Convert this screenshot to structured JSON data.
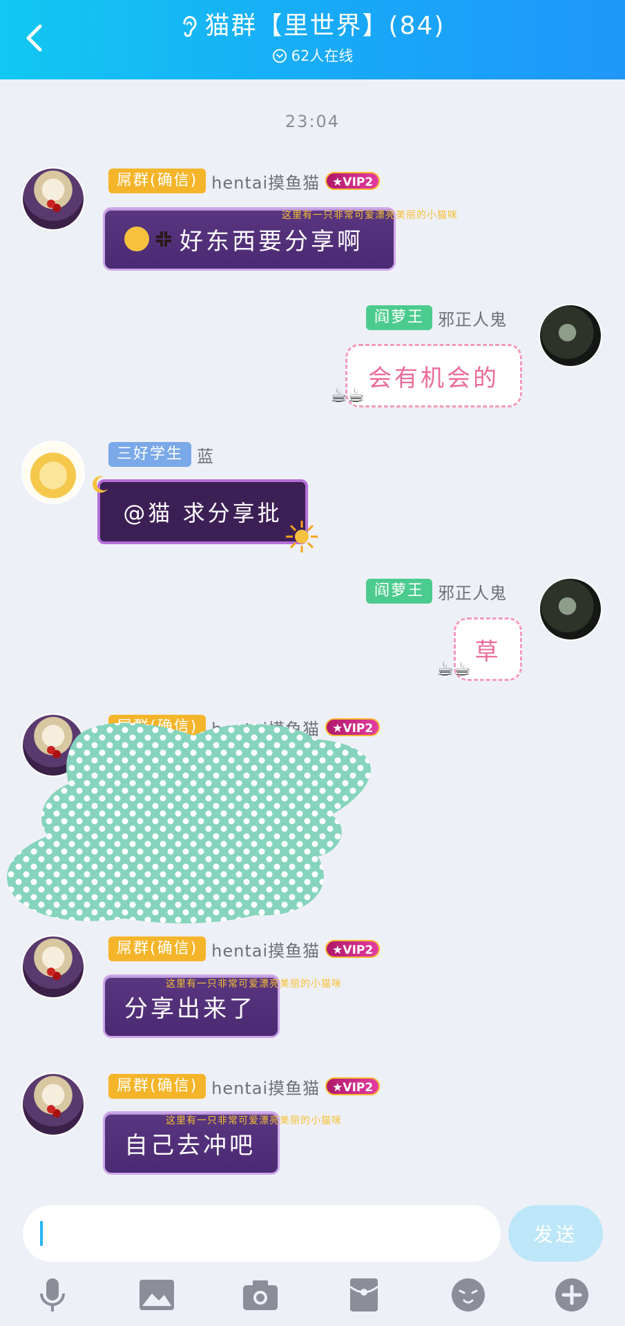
{
  "header": {
    "title": "猫群【里世界】(84)",
    "online": "62人在线"
  },
  "timestamp": "23:04",
  "messages": [
    {
      "badge": "屌群(确信)",
      "nick": "hentai摸鱼猫",
      "vip": "VIP2",
      "note": "这里有一只非常可爱漂亮美丽的小猫咪",
      "text": "好东西要分享啊"
    },
    {
      "badge": "阎萝王",
      "nick": "邪正人鬼",
      "text": "会有机会的"
    },
    {
      "badge": "三好学生",
      "nick": "蓝",
      "text": "@猫 求分享批"
    },
    {
      "badge": "阎萝王",
      "nick": "邪正人鬼",
      "text": "草"
    },
    {
      "badge": "屌群(确信)",
      "nick": "hentai摸鱼猫",
      "vip": "VIP2"
    },
    {
      "badge": "屌群(确信)",
      "nick": "hentai摸鱼猫",
      "vip": "VIP2",
      "note": "这里有一只非常可爱漂亮美丽的小猫咪",
      "text": "分享出来了"
    },
    {
      "badge": "屌群(确信)",
      "nick": "hentai摸鱼猫",
      "vip": "VIP2",
      "note": "这里有一只非常可爱漂亮美丽的小猫咪",
      "text": "自己去冲吧"
    }
  ],
  "input": {
    "send_label": "发送"
  },
  "toolbar": [
    "mic-icon",
    "image-icon",
    "camera-icon",
    "red-packet-icon",
    "emoji-icon",
    "plus-icon"
  ],
  "colors": {
    "header_start": "#12c8f2",
    "header_end": "#1e97fb",
    "badge_gold": "#f5b52a",
    "badge_green": "#4ccb8e",
    "badge_blue": "#7aa8e8",
    "send_bg": "#bde7f8"
  }
}
